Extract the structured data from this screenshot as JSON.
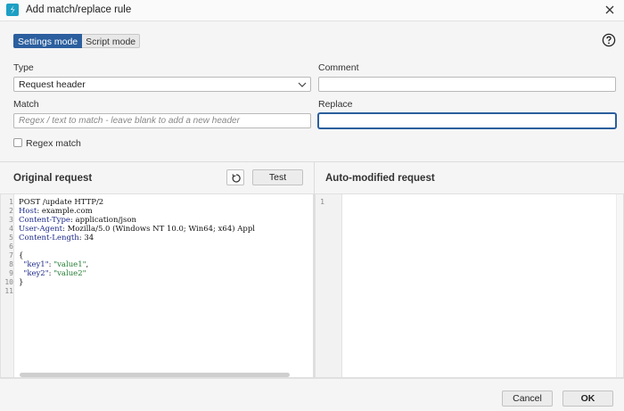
{
  "window": {
    "title": "Add match/replace rule",
    "app_icon": "burp-logo-icon",
    "close_icon": "close-icon"
  },
  "modes": {
    "settings": "Settings mode",
    "script": "Script mode",
    "help_icon": "help-icon"
  },
  "form": {
    "type_label": "Type",
    "type_value": "Request header",
    "comment_label": "Comment",
    "comment_value": "",
    "match_label": "Match",
    "match_placeholder": "Regex / text to match - leave blank to add a new header",
    "replace_label": "Replace",
    "replace_value": "",
    "regex_label": "Regex match",
    "regex_checked": false
  },
  "original": {
    "title": "Original request",
    "test_label": "Test",
    "reset_icon": "reset-icon",
    "lines": [
      {
        "n": "1",
        "parts": [
          {
            "t": "POST /update HTTP/2",
            "c": ""
          }
        ]
      },
      {
        "n": "2",
        "parts": [
          {
            "t": "Host",
            "c": "k-blue"
          },
          {
            "t": ": example.com",
            "c": ""
          }
        ]
      },
      {
        "n": "3",
        "parts": [
          {
            "t": "Content-Type",
            "c": "k-blue"
          },
          {
            "t": ": application/json",
            "c": ""
          }
        ]
      },
      {
        "n": "4",
        "parts": [
          {
            "t": "User-Agent",
            "c": "k-blue"
          },
          {
            "t": ": Mozilla/5.0 (Windows NT 10.0; Win64; x64) Appl",
            "c": ""
          }
        ]
      },
      {
        "n": "5",
        "parts": [
          {
            "t": "Content-Length",
            "c": "k-blue"
          },
          {
            "t": ": 34",
            "c": ""
          }
        ]
      },
      {
        "n": "6",
        "parts": []
      },
      {
        "n": "7",
        "parts": [
          {
            "t": "{",
            "c": ""
          }
        ]
      },
      {
        "n": "8",
        "parts": [
          {
            "t": "  \"key1\"",
            "c": "k-blue"
          },
          {
            "t": ": ",
            "c": ""
          },
          {
            "t": "\"value1\"",
            "c": "k-green"
          },
          {
            "t": ",",
            "c": ""
          }
        ]
      },
      {
        "n": "9",
        "parts": [
          {
            "t": "  \"key2\"",
            "c": "k-blue"
          },
          {
            "t": ": ",
            "c": ""
          },
          {
            "t": "\"value2\"",
            "c": "k-green"
          }
        ]
      },
      {
        "n": "10",
        "parts": [
          {
            "t": "}",
            "c": ""
          }
        ]
      },
      {
        "n": "11",
        "parts": []
      }
    ]
  },
  "modified": {
    "title": "Auto-modified request",
    "lines": [
      {
        "n": "1"
      }
    ]
  },
  "footer": {
    "cancel": "Cancel",
    "ok": "OK"
  }
}
